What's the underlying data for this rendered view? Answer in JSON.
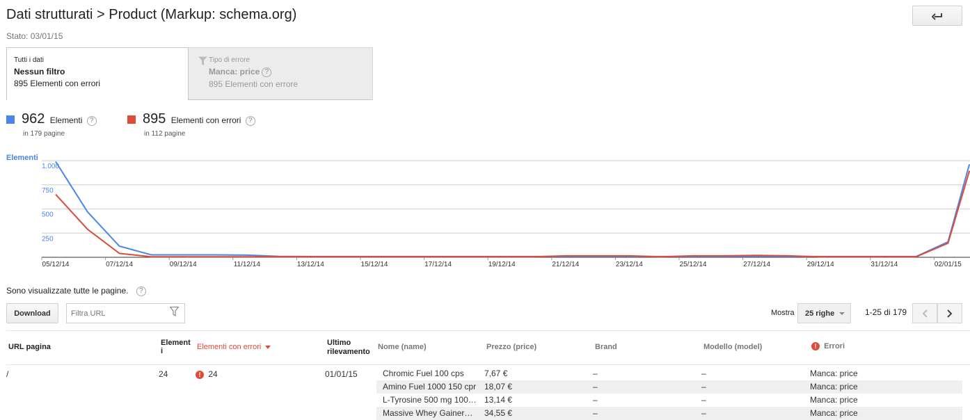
{
  "header": {
    "title": "Dati strutturati > Product (Markup: schema.org)",
    "status": "Stato: 03/01/15",
    "back_icon": "back-arrow-icon"
  },
  "tabs": [
    {
      "small": "Tutti i dati",
      "main": "Nessun filtro",
      "sub": "895 Elementi con errori",
      "active": true
    },
    {
      "small": "Tipo di errore",
      "main": "Manca: price",
      "sub": "895 Elementi con errore",
      "active": false,
      "icon": "funnel-icon"
    }
  ],
  "legend": {
    "items": [
      {
        "value": "962",
        "label": "Elementi",
        "sub": "in 179 pagine",
        "color": "#4a86e8"
      },
      {
        "value": "895",
        "label": "Elementi con errori",
        "sub": "in 112 pagine",
        "color": "#dd4b39"
      }
    ]
  },
  "chart_data": {
    "type": "line",
    "ylabel": "Elementi",
    "ylim": [
      0,
      1000
    ],
    "yticks": [
      1000,
      750,
      500,
      250
    ],
    "ytick_labels": [
      "1.000",
      "750",
      "500",
      "250"
    ],
    "x_labels": [
      "05/12/14",
      "07/12/14",
      "09/12/14",
      "11/12/14",
      "13/12/14",
      "15/12/14",
      "17/12/14",
      "19/12/14",
      "21/12/14",
      "23/12/14",
      "25/12/14",
      "27/12/14",
      "29/12/14",
      "31/12/14",
      "02/01/15"
    ],
    "grid": true,
    "series": [
      {
        "name": "Elementi",
        "color": "#4a86e8",
        "values": [
          990,
          470,
          115,
          25,
          25,
          25,
          22,
          10,
          8,
          8,
          8,
          8,
          8,
          8,
          8,
          8,
          8,
          8,
          8,
          8,
          8,
          8,
          8,
          8,
          8,
          8,
          8,
          8,
          160,
          960,
          962
        ]
      },
      {
        "name": "Elementi con errori",
        "color": "#dd4b39",
        "values": [
          650,
          290,
          40,
          5,
          5,
          5,
          5,
          5,
          5,
          5,
          5,
          5,
          5,
          5,
          5,
          5,
          15,
          15,
          15,
          5,
          15,
          15,
          20,
          15,
          5,
          5,
          5,
          5,
          145,
          890,
          895
        ]
      }
    ]
  },
  "info": {
    "text": "Sono visualizzate tutte le pagine."
  },
  "toolbar": {
    "download_label": "Download",
    "filter_placeholder": "Filtra URL",
    "show_label": "Mostra",
    "rows_value": "25 righe",
    "pager_text": "1-25 di 179"
  },
  "table": {
    "headers": {
      "url": "URL pagina",
      "items_line1": "Element",
      "items_line2": "i",
      "errors": "Elementi con errori",
      "last_line1": "Ultimo",
      "last_line2": "rilevamento",
      "name": "Nome (name)",
      "price": "Prezzo (price)",
      "brand": "Brand",
      "model": "Modello (model)",
      "err": "Errori"
    },
    "row": {
      "url": "/",
      "items": "24",
      "errors": "24",
      "last": "01/01/15"
    },
    "sub_rows": [
      {
        "name": "Chromic Fuel 100 cps",
        "price": "7,67 €",
        "brand": "–",
        "model": "–",
        "err": "Manca: price"
      },
      {
        "name": "Amino Fuel 1000 150 cpr",
        "price": "18,07 €",
        "brand": "–",
        "model": "–",
        "err": "Manca: price"
      },
      {
        "name": "L-Tyrosine 500 mg 100…",
        "price": "13,14 €",
        "brand": "–",
        "model": "–",
        "err": "Manca: price"
      },
      {
        "name": "Massive Whey Gainer…",
        "price": "34,55 €",
        "brand": "–",
        "model": "–",
        "err": "Manca: price"
      }
    ]
  }
}
